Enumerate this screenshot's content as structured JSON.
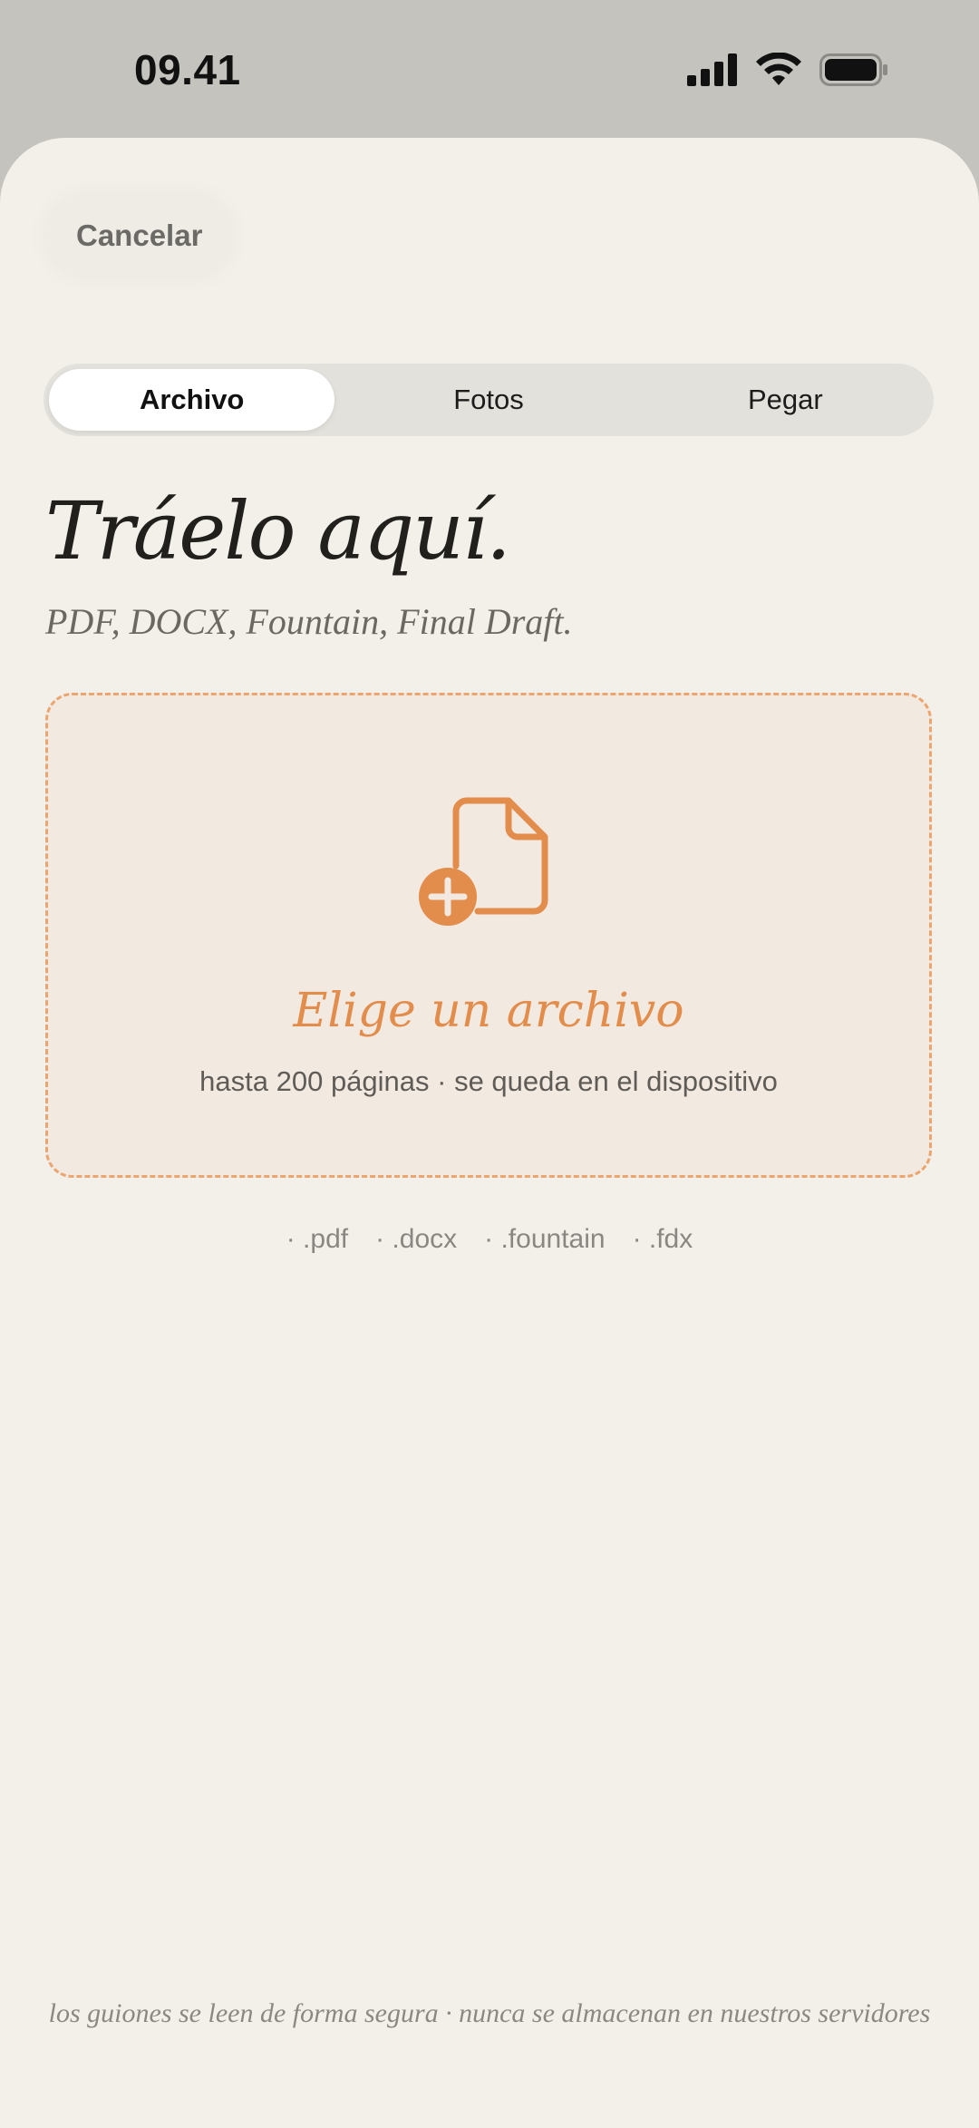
{
  "status_bar": {
    "time": "09.41",
    "signal_icon": "cellular-signal-icon",
    "wifi_icon": "wifi-icon",
    "battery_icon": "battery-icon"
  },
  "header": {
    "cancel_label": "Cancelar"
  },
  "tabs": [
    {
      "label": "Archivo",
      "active": true
    },
    {
      "label": "Fotos",
      "active": false
    },
    {
      "label": "Pegar",
      "active": false
    }
  ],
  "main": {
    "title": "Tráelo aquí.",
    "subtitle": "PDF, DOCX, Fountain, Final Draft."
  },
  "dropzone": {
    "icon": "file-add-icon",
    "title": "Elige un archivo",
    "subtitle": "hasta 200 páginas · se queda en el dispositivo"
  },
  "extensions": [
    "· .pdf",
    "· .docx",
    "· .fountain",
    "· .fdx"
  ],
  "footer": {
    "note": "los guiones se leen de forma segura · nunca se almacenan en nuestros servidores"
  },
  "colors": {
    "accent": "#e28d4c",
    "background": "#f3f0ea",
    "dropzone_border": "#eba66f"
  }
}
